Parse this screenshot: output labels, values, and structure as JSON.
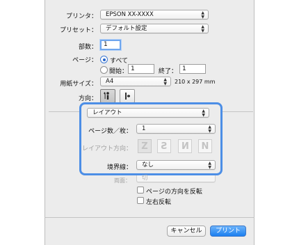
{
  "printer": {
    "label": "プリンタ：",
    "value": "EPSON XX-XXXX"
  },
  "preset": {
    "label": "プリセット：",
    "value": "デフォルト設定"
  },
  "copies": {
    "label": "部数：",
    "value": "1"
  },
  "pages": {
    "label": "ページ：",
    "all_label": "すべて",
    "from_label": "開始：",
    "from_value": "1",
    "to_label": "終了：",
    "to_value": "1",
    "selected": "all"
  },
  "paper_size": {
    "label": "用紙サイズ：",
    "value": "A4",
    "dimensions": "210 x 297 mm"
  },
  "orientation": {
    "label": "方向：",
    "selected": "portrait"
  },
  "section_popup": {
    "value": "レイアウト"
  },
  "layout": {
    "pages_per_sheet": {
      "label": "ページ数／枚：",
      "value": "1"
    },
    "direction": {
      "label": "レイアウト方向：",
      "options": [
        "Z",
        "S",
        "N",
        "N"
      ],
      "enabled": false
    },
    "border": {
      "label": "境界線：",
      "value": "なし"
    }
  },
  "two_sided": {
    "label": "両面：",
    "value": "切",
    "enabled": false
  },
  "reverse_orientation": {
    "label": "ページの方向を反転",
    "checked": false
  },
  "flip_horizontal": {
    "label": "左右反転",
    "checked": false
  },
  "buttons": {
    "cancel": "キャンセル",
    "print": "プリント"
  },
  "colors": {
    "accent": "#4c8ee6",
    "primary_button": "#1b7ff0",
    "sheet_bg": "#ececec"
  }
}
